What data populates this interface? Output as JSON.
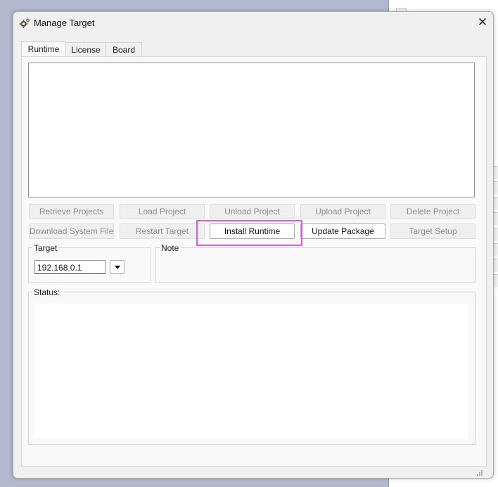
{
  "background_app": {
    "text_fragment": ""
  },
  "dialog": {
    "title": "Manage Target",
    "close_glyph": "✕",
    "tabs": [
      {
        "label": "Runtime",
        "active": true
      },
      {
        "label": "License",
        "active": false
      },
      {
        "label": "Board",
        "active": false
      }
    ],
    "buttons_row1": [
      {
        "label": "Retrieve Projects",
        "enabled": false
      },
      {
        "label": "Load Project",
        "enabled": false
      },
      {
        "label": "Unload Project",
        "enabled": false
      },
      {
        "label": "Upload Project",
        "enabled": false
      },
      {
        "label": "Delete Project",
        "enabled": false
      }
    ],
    "buttons_row2": [
      {
        "label": "Download System Files",
        "enabled": false
      },
      {
        "label": "Restart Target",
        "enabled": false
      },
      {
        "label": "Install Runtime",
        "enabled": true,
        "highlighted": true
      },
      {
        "label": "Update Package",
        "enabled": true
      },
      {
        "label": "Target Setup",
        "enabled": false
      }
    ],
    "target_group": {
      "label": "Target",
      "ip_value": "192.168.0.1"
    },
    "note_group": {
      "label": "Note"
    },
    "status_group": {
      "label": "Status:"
    }
  },
  "colors": {
    "highlight": "#e05ae8",
    "desktop": "#b4b8cf",
    "dialog_bg": "#f0f0f0"
  },
  "icons": [
    "gear-app-icon",
    "close-icon",
    "dropdown-arrow-icon",
    "folder-icon",
    "resize-grip-icon"
  ]
}
